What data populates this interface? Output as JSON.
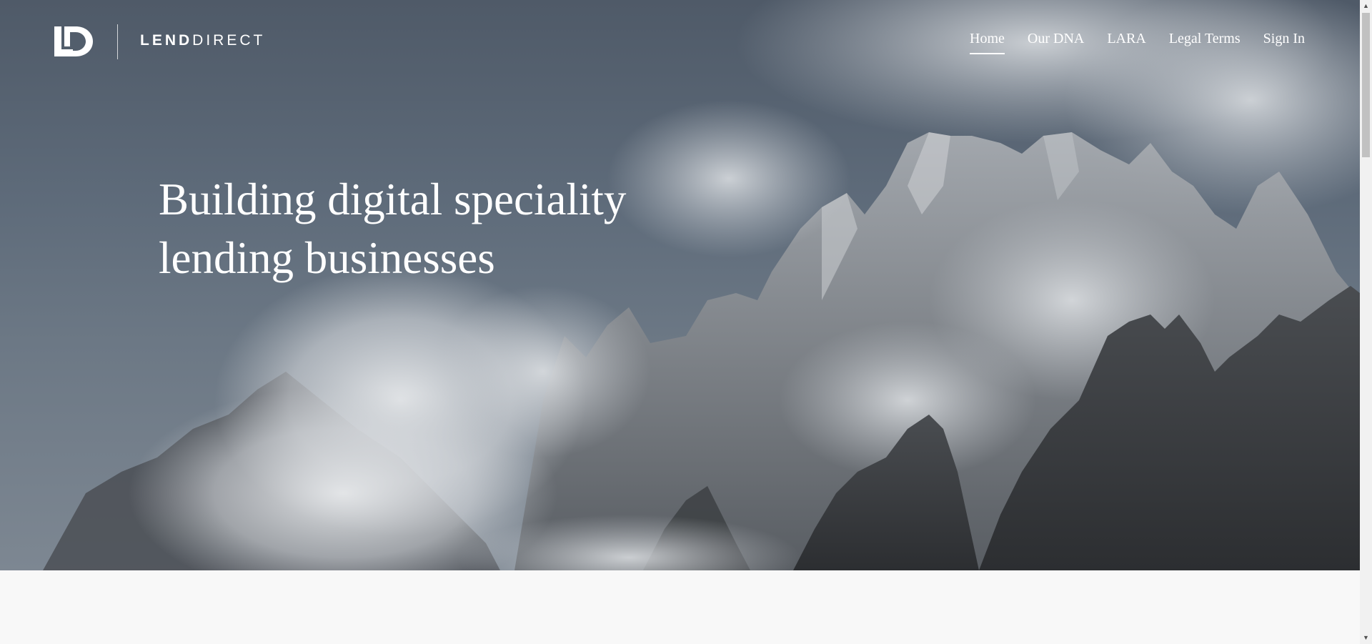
{
  "brand": {
    "mark": "LD",
    "name_strong": "LEND",
    "name_light": "DIRECT"
  },
  "nav": {
    "items": [
      {
        "label": "Home",
        "active": true
      },
      {
        "label": "Our DNA",
        "active": false
      },
      {
        "label": "LARA",
        "active": false
      },
      {
        "label": "Legal Terms",
        "active": false
      },
      {
        "label": "Sign In",
        "active": false
      }
    ]
  },
  "hero": {
    "headline_line1": "Building digital speciality",
    "headline_line2": "lending businesses"
  },
  "scrollbar": {
    "up_icon": "chevron-up-icon",
    "down_icon": "chevron-down-icon"
  },
  "colors": {
    "sky": "#55606e",
    "text": "#ffffff",
    "below_background": "#f8f8f8"
  }
}
